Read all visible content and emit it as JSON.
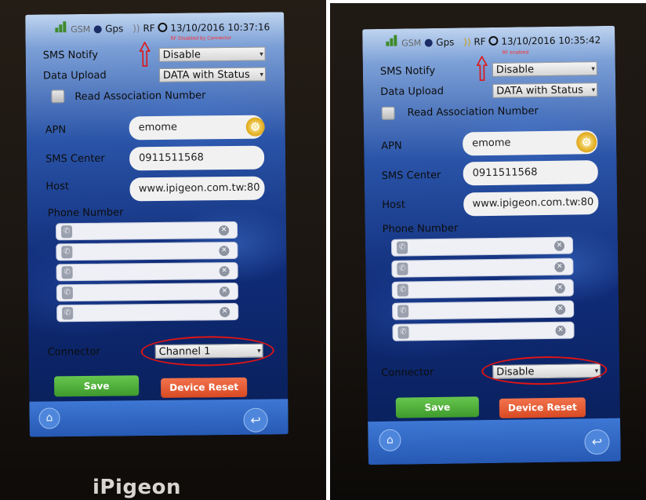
{
  "brand": "iPigeon",
  "screenshots": [
    {
      "status_bar": {
        "gsm": "GSM",
        "gps": "Gps",
        "rf": "RF",
        "datetime": "13/10/2016 10:37:16"
      },
      "rf_annotation": "RF Disabled by Connector",
      "sms_notify": {
        "label": "SMS Notify",
        "value": "Disable"
      },
      "data_upload": {
        "label": "Data Upload",
        "value": "DATA with Status"
      },
      "read_association": "Read Association Number",
      "apn": {
        "label": "APN",
        "value": "emome"
      },
      "sms_center": {
        "label": "SMS Center",
        "value": "0911511568"
      },
      "host": {
        "label": "Host",
        "value": "www.ipigeon.com.tw:80"
      },
      "phone_number_label": "Phone Number",
      "connector": {
        "label": "Connector",
        "value": "Channel 1"
      },
      "save_label": "Save",
      "reset_label": "Device Reset"
    },
    {
      "status_bar": {
        "gsm": "GSM",
        "gps": "Gps",
        "rf": "RF",
        "datetime": "13/10/2016 10:35:42"
      },
      "rf_annotation": "RF enabled",
      "sms_notify": {
        "label": "SMS Notify",
        "value": "Disable"
      },
      "data_upload": {
        "label": "Data Upload",
        "value": "DATA with Status"
      },
      "read_association": "Read Association Number",
      "apn": {
        "label": "APN",
        "value": "emome"
      },
      "sms_center": {
        "label": "SMS Center",
        "value": "0911511568"
      },
      "host": {
        "label": "Host",
        "value": "www.ipigeon.com.tw:80"
      },
      "phone_number_label": "Phone Number",
      "connector": {
        "label": "Connector",
        "value": "Disable"
      },
      "save_label": "Save",
      "reset_label": "Device Reset"
    }
  ],
  "icons": {
    "gps": "map-pin-icon",
    "rf": "rf-signal-icon",
    "clock": "clock-icon",
    "gear": "gear-icon",
    "phone": "phone-icon",
    "clear": "clear-icon",
    "home": "home-icon",
    "back": "back-icon"
  },
  "colors": {
    "save": "#4caf37",
    "reset": "#e25a30",
    "annotation": "#e01414"
  }
}
